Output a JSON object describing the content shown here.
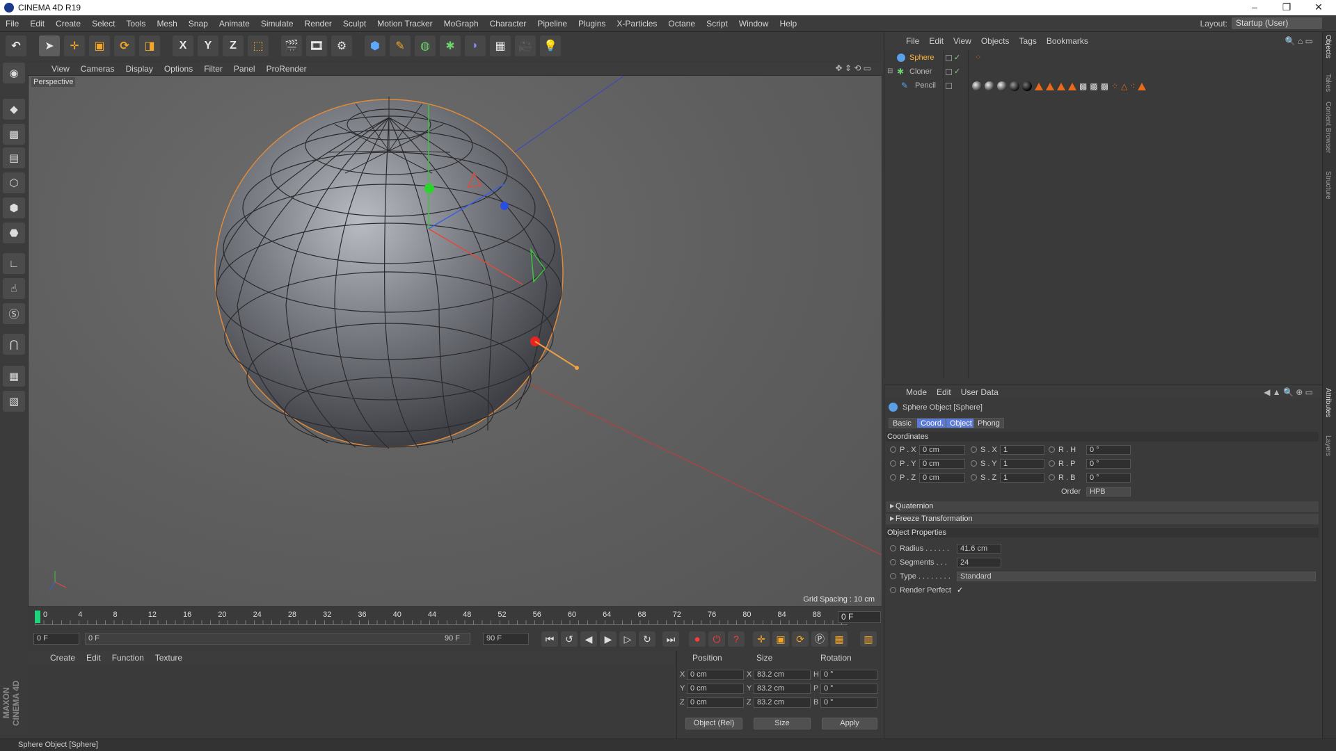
{
  "window": {
    "title": "CINEMA 4D R19",
    "minimize": "–",
    "maximize": "❐",
    "close": "✕"
  },
  "menubar": {
    "items": [
      "File",
      "Edit",
      "Create",
      "Select",
      "Tools",
      "Mesh",
      "Snap",
      "Animate",
      "Simulate",
      "Render",
      "Sculpt",
      "Motion Tracker",
      "MoGraph",
      "Character",
      "Pipeline",
      "Plugins",
      "X-Particles",
      "Octane",
      "Script",
      "Window",
      "Help"
    ],
    "layout_label": "Layout:",
    "layout_value": "Startup (User)"
  },
  "toolbar": {
    "undo": "↶",
    "x_lock": "X",
    "y_lock": "Y",
    "z_lock": "Z"
  },
  "viewport": {
    "menu": [
      "View",
      "Cameras",
      "Display",
      "Options",
      "Filter",
      "Panel",
      "ProRender"
    ],
    "camera_label": "Perspective",
    "grid_spacing": "Grid Spacing : 10 cm"
  },
  "timeline": {
    "ticks": [
      "0",
      "4",
      "8",
      "12",
      "16",
      "20",
      "24",
      "28",
      "32",
      "36",
      "40",
      "44",
      "48",
      "52",
      "56",
      "60",
      "64",
      "68",
      "72",
      "76",
      "80",
      "84",
      "88"
    ],
    "current_frame": "0 F",
    "start_frame": "0 F",
    "range_start": "0 F",
    "range_end": "90 F",
    "end_frame": "90 F"
  },
  "material_manager": {
    "menu": [
      "Create",
      "Edit",
      "Function",
      "Texture"
    ]
  },
  "coord_manager": {
    "headers": {
      "position": "Position",
      "size": "Size",
      "rotation": "Rotation"
    },
    "rows": [
      {
        "axis": "X",
        "pos": "0 cm",
        "size_axis": "X",
        "size": "83.2 cm",
        "rot_axis": "H",
        "rot": "0 °"
      },
      {
        "axis": "Y",
        "pos": "0 cm",
        "size_axis": "Y",
        "size": "83.2 cm",
        "rot_axis": "P",
        "rot": "0 °"
      },
      {
        "axis": "Z",
        "pos": "0 cm",
        "size_axis": "Z",
        "size": "83.2 cm",
        "rot_axis": "B",
        "rot": "0 °"
      }
    ],
    "mode": "Object (Rel)",
    "size_mode": "Size",
    "apply": "Apply"
  },
  "object_manager": {
    "menu": [
      "File",
      "Edit",
      "View",
      "Objects",
      "Tags",
      "Bookmarks"
    ],
    "objects": [
      {
        "name": "Sphere",
        "selected": true
      },
      {
        "name": "Cloner",
        "selected": false
      },
      {
        "name": "Pencil",
        "selected": false
      }
    ]
  },
  "attribute_manager": {
    "menu": [
      "Mode",
      "Edit",
      "User Data"
    ],
    "object_title": "Sphere Object [Sphere]",
    "tabs": [
      "Basic",
      "Coord.",
      "Object",
      "Phong"
    ],
    "coordinates_heading": "Coordinates",
    "coords": [
      {
        "p_label": "P . X",
        "p": "0 cm",
        "s_label": "S . X",
        "s": "1",
        "r_label": "R . H",
        "r": "0 °"
      },
      {
        "p_label": "P . Y",
        "p": "0 cm",
        "s_label": "S . Y",
        "s": "1",
        "r_label": "R . P",
        "r": "0 °"
      },
      {
        "p_label": "P . Z",
        "p": "0 cm",
        "s_label": "S . Z",
        "s": "1",
        "r_label": "R . B",
        "r": "0 °"
      }
    ],
    "order_label": "Order",
    "order_value": "HPB",
    "quaternion": "Quaternion",
    "freeze": "Freeze Transformation",
    "object_props_heading": "Object Properties",
    "radius_label": "Radius . . . . . .",
    "radius": "41.6 cm",
    "segments_label": "Segments . . .",
    "segments": "24",
    "type_label": "Type . . . . . . . .",
    "type": "Standard",
    "render_perfect_label": "Render Perfect",
    "render_perfect": "✓"
  },
  "right_strip": [
    "Objects",
    "Takes",
    "Content Browser",
    "Structure",
    "Attributes",
    "Layers"
  ],
  "status": "Sphere Object [Sphere]",
  "brand": "MAXON CINEMA 4D"
}
